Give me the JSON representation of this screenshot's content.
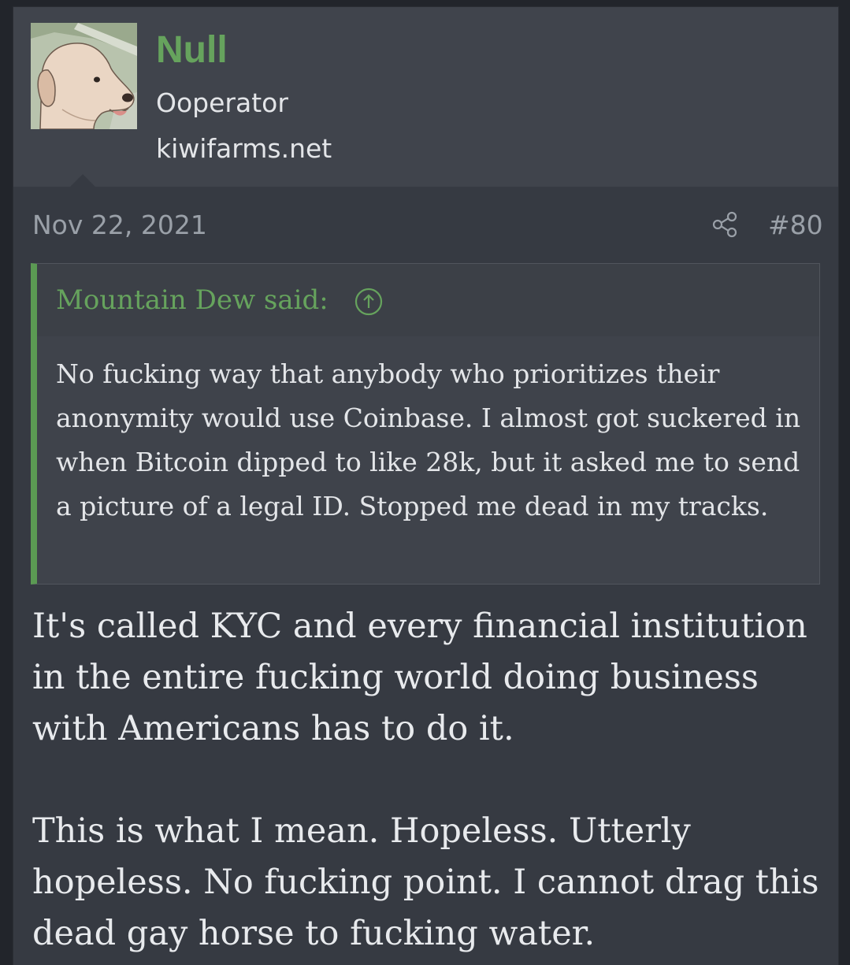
{
  "user": {
    "name": "Null",
    "title": "Ooperator",
    "site": "kiwifarms.net",
    "avatar": "dog-illustration"
  },
  "post": {
    "date": "Nov 22, 2021",
    "number": "#80",
    "share_icon": "share-icon"
  },
  "quote": {
    "author": "Mountain Dew said:",
    "jump_icon": "arrow-up-circle-icon",
    "text": "No fucking way that anybody who prioritizes their anonymity would use Coinbase. I almost got suckered in when Bitcoin dipped to like 28k, but it asked me to send a picture of a legal ID. Stopped me dead in my tracks."
  },
  "message": {
    "paragraphs": [
      "It's called KYC and every financial institution in the entire fucking world doing business with Americans has to do it.",
      "This is what I mean. Hopeless. Utterly hopeless. No fucking point. I cannot drag this dead gay horse to fucking water."
    ]
  },
  "colors": {
    "accent_green": "#66a35d",
    "quote_border": "#5b9a53",
    "post_bg": "#363a42",
    "header_bg": "#40444c",
    "text": "#e3e5e8",
    "muted": "#9aa0a8"
  }
}
